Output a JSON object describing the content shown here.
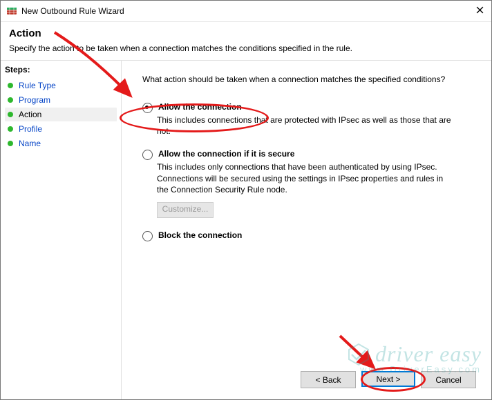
{
  "window": {
    "title": "New Outbound Rule Wizard"
  },
  "header": {
    "heading": "Action",
    "subtitle": "Specify the action to be taken when a connection matches the conditions specified in the rule."
  },
  "sidebar": {
    "steps_label": "Steps:",
    "items": [
      {
        "label": "Rule Type",
        "current": false
      },
      {
        "label": "Program",
        "current": false
      },
      {
        "label": "Action",
        "current": true
      },
      {
        "label": "Profile",
        "current": false
      },
      {
        "label": "Name",
        "current": false
      }
    ]
  },
  "main": {
    "question": "What action should be taken when a connection matches the specified conditions?",
    "options": [
      {
        "id": "allow",
        "label": "Allow the connection",
        "desc": "This includes connections that are protected with IPsec as well as those that are not.",
        "checked": true
      },
      {
        "id": "allow_secure",
        "label": "Allow the connection if it is secure",
        "desc": "This includes only connections that have been authenticated by using IPsec. Connections will be secured using the settings in IPsec properties and rules in the Connection Security Rule node.",
        "checked": false
      },
      {
        "id": "block",
        "label": "Block the connection",
        "desc": "",
        "checked": false
      }
    ],
    "customize_label": "Customize...",
    "customize_enabled": false
  },
  "buttons": {
    "back": "< Back",
    "next": "Next >",
    "cancel": "Cancel"
  },
  "watermark": {
    "line1": "driver easy",
    "line2": "www.DriverEasy.com"
  },
  "annotation_color": "#e41a1a"
}
